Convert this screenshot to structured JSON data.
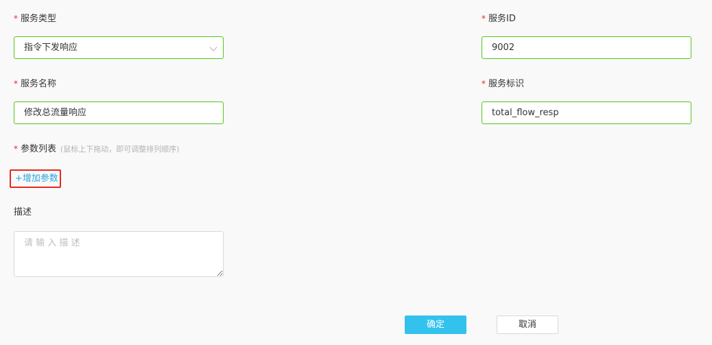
{
  "form": {
    "required_mark": "*",
    "service_type": {
      "label": "服务类型",
      "value": "指令下发响应"
    },
    "service_id": {
      "label": "服务ID",
      "value": "9002"
    },
    "service_name": {
      "label": "服务名称",
      "value": "修改总流量响应"
    },
    "service_identifier": {
      "label": "服务标识",
      "value": "total_flow_resp"
    },
    "params": {
      "label": "参数列表",
      "hint": "(鼠标上下拖动，即可调整排列顺序)",
      "add_label": "+增加参数"
    },
    "description": {
      "label": "描述",
      "placeholder": "请 输 入 描 述",
      "value": ""
    }
  },
  "actions": {
    "confirm_label": "确定",
    "cancel_label": "取消"
  },
  "colors": {
    "required": "#f5222d",
    "valid_border": "#52c41a",
    "link": "#2aa5e0",
    "highlight_box": "#e8261e",
    "primary_button": "#33c2ee"
  },
  "icons": {
    "select_arrow": "chevron-down-icon"
  }
}
